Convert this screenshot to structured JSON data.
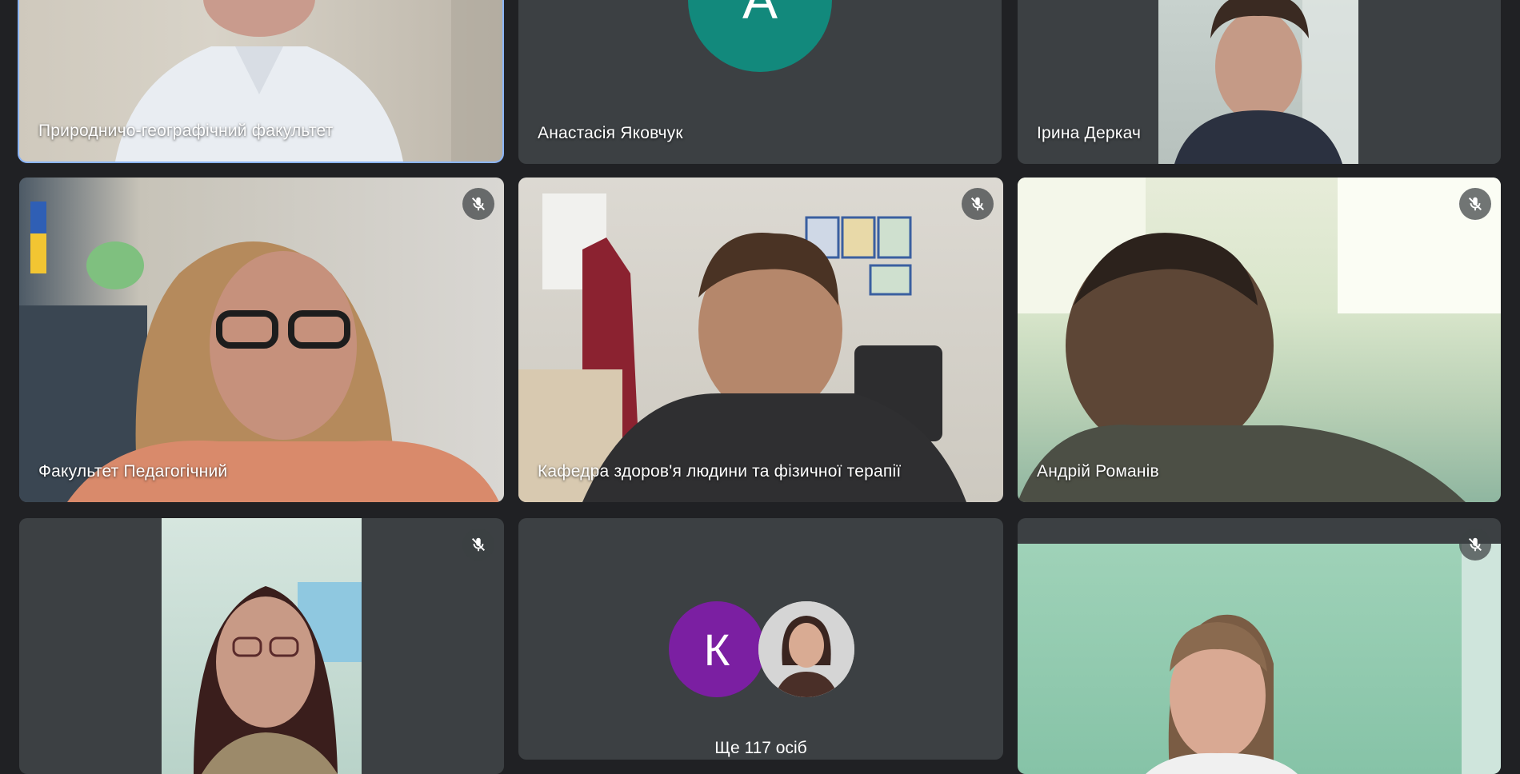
{
  "participants": [
    {
      "name": "Природничо-географічний факультет",
      "speaking": true
    },
    {
      "name": "Анастасія Яковчук",
      "initial": "А",
      "avatar_color": "#12897c"
    },
    {
      "name": "Ірина Деркач"
    },
    {
      "name": "Факультет Педагогічний",
      "muted": true
    },
    {
      "name": "Кафедра здоров'я людини та фізичної терапії",
      "muted": true
    },
    {
      "name": "Андрій Романів",
      "muted": true
    },
    {
      "name": "",
      "muted": true
    },
    {
      "name": "",
      "muted": true
    }
  ],
  "overflow": {
    "avatar_initial": "К",
    "avatar_color": "#7b1fa2",
    "label": "Ще 117 осіб"
  },
  "icons": {
    "mute": "mic-off-icon"
  },
  "colors": {
    "background": "#202124",
    "tile": "#3c4043",
    "active_outline": "#8ab4f8"
  }
}
